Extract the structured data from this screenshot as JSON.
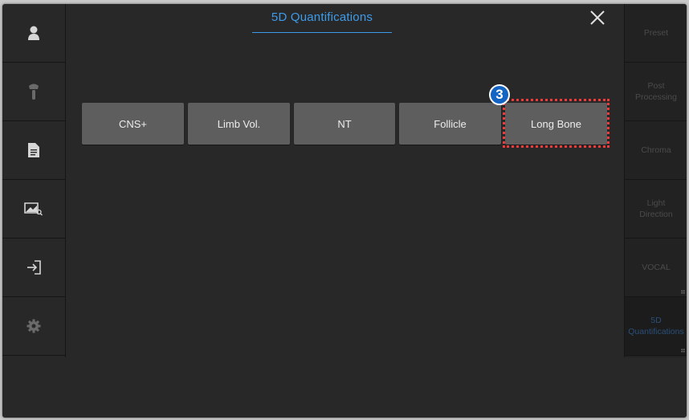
{
  "dialog": {
    "title": "5D Quantifications",
    "close_icon": "close-icon"
  },
  "left_sidebar": {
    "items": [
      {
        "name": "patient",
        "icon": "person-icon"
      },
      {
        "name": "probe",
        "icon": "probe-icon"
      },
      {
        "name": "report",
        "icon": "document-icon"
      },
      {
        "name": "review",
        "icon": "image-search-icon"
      },
      {
        "name": "exit",
        "icon": "exit-icon"
      },
      {
        "name": "settings",
        "icon": "gear-icon"
      }
    ]
  },
  "quantifications": {
    "buttons": [
      {
        "label": "CNS+"
      },
      {
        "label": "Limb Vol."
      },
      {
        "label": "NT"
      },
      {
        "label": "Follicle"
      },
      {
        "label": "Long Bone",
        "highlighted": true
      }
    ],
    "step_badge": "3",
    "highlight_color": "#ee3a3a"
  },
  "right_bar": {
    "items": [
      {
        "label": "Preset"
      },
      {
        "label": "Post\nProcessing"
      },
      {
        "label": "Chroma"
      },
      {
        "label": "Light\nDirection"
      },
      {
        "label": "VOCAL"
      },
      {
        "label": "5D\nQuantifications",
        "active": true
      }
    ]
  },
  "colors": {
    "accent": "#3d9be9",
    "background": "#282828",
    "button": "#5e5e5e"
  }
}
